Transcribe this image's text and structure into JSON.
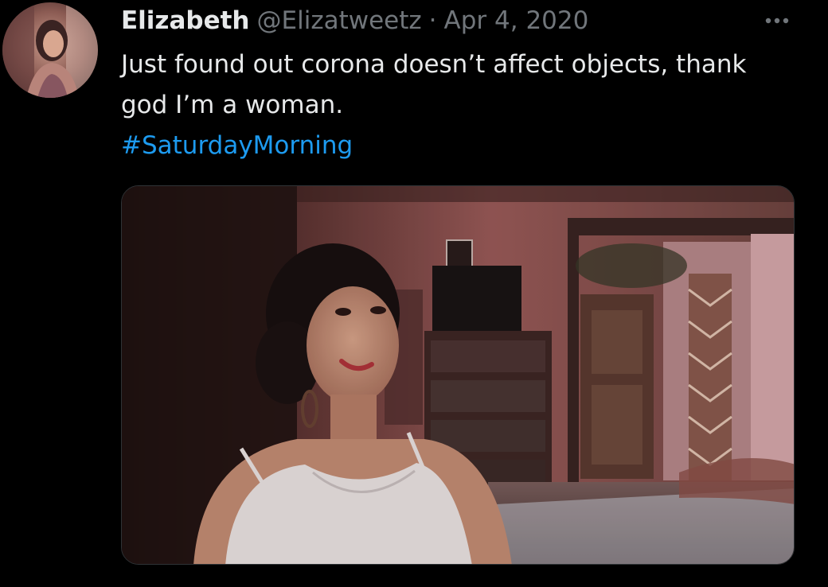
{
  "tweet": {
    "author": {
      "display_name": "Elizabeth",
      "handle": "@Elizatweetz",
      "avatar_icon": "user-avatar"
    },
    "separator": "·",
    "date": "Apr 4, 2020",
    "more_icon": "more-horizontal-icon",
    "text_lines": [
      "Just found out corona doesn’t affect objects, thank",
      "god I’m a woman."
    ],
    "hashtag": "#SaturdayMorning",
    "media": {
      "type": "photo"
    }
  },
  "colors": {
    "background": "#000000",
    "primary_text": "#e7e9ea",
    "secondary_text": "#71767b",
    "link": "#1d9bf0"
  }
}
